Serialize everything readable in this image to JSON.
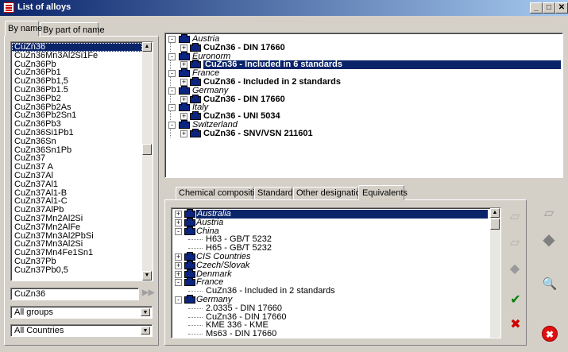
{
  "window": {
    "title": "List of alloys",
    "minimize": "_",
    "maximize": "□",
    "close": "✕"
  },
  "left_tabs": {
    "by_name": "By name",
    "by_part": "By part of name"
  },
  "alloys": [
    "CuZn36",
    "CuZn36Mn3Al2Si1Fe",
    "CuZn36Pb",
    "CuZn36Pb1",
    "CuZn36Pb1,5",
    "CuZn36Pb1.5",
    "CuZn36Pb2",
    "CuZn36Pb2As",
    "CuZn36Pb2Sn1",
    "CuZn36Pb3",
    "CuZn36Si1Pb1",
    "CuZn36Sn",
    "CuZn36Sn1Pb",
    "CuZn37",
    "CuZn37 A",
    "CuZn37Al",
    "CuZn37Al1",
    "CuZn37Al1-B",
    "CuZn37Al1-C",
    "CuZn37AlPb",
    "CuZn37Mn2Al2Si",
    "CuZn37Mn2AlFe",
    "CuZn37Mn3Al2PbSi",
    "CuZn37Mn3Al2Si",
    "CuZn37Mn4Fe1Sn1",
    "CuZn37Pb",
    "CuZn37Pb0,5"
  ],
  "search": {
    "value": "CuZn36",
    "go": "▶▶"
  },
  "groups": {
    "value": "All groups"
  },
  "countries": {
    "value": "All Countries"
  },
  "standards_tree": [
    {
      "country": "Austria",
      "entry": "CuZn36  -  DIN 17660",
      "selected": false
    },
    {
      "country": "Euronorm",
      "entry": "CuZn36  -  Included in 6 standards",
      "selected": true
    },
    {
      "country": "France",
      "entry": "CuZn36  -  Included in 2 standards",
      "selected": false
    },
    {
      "country": "Germany",
      "entry": "CuZn36  -  DIN 17660",
      "selected": false
    },
    {
      "country": "Italy",
      "entry": "CuZn36  -  UNI 5034",
      "selected": false
    },
    {
      "country": "Switzerland",
      "entry": "CuZn36  -  SNV/VSN 211601",
      "selected": false
    }
  ],
  "detail_tabs": [
    "Chemical composition",
    "Standards",
    "Other designations",
    "Equivalents"
  ],
  "equivalents": [
    {
      "label": "Australia",
      "type": "country",
      "expander": "+",
      "selected": true
    },
    {
      "label": "Austria",
      "type": "country",
      "expander": "+"
    },
    {
      "label": "China",
      "type": "country",
      "expander": "-"
    },
    {
      "label": "H63  -  GB/T 5232",
      "type": "leaf"
    },
    {
      "label": "H65  -  GB/T 5232",
      "type": "leaf"
    },
    {
      "label": "CIS Countries",
      "type": "country",
      "expander": "+"
    },
    {
      "label": "Czech/Slovak",
      "type": "country",
      "expander": "+"
    },
    {
      "label": "Denmark",
      "type": "country",
      "expander": "+"
    },
    {
      "label": "France",
      "type": "country",
      "expander": "-"
    },
    {
      "label": "CuZn36  -  Included in 2 standards",
      "type": "leaf"
    },
    {
      "label": "Germany",
      "type": "country",
      "expander": "-"
    },
    {
      "label": "2.0335  -  DIN 17660",
      "type": "leaf"
    },
    {
      "label": "CuZn36  -  DIN 17660",
      "type": "leaf"
    },
    {
      "label": "KME 336  -  KME",
      "type": "leaf"
    },
    {
      "label": "Ms63  -  DIN 17660",
      "type": "leaf"
    }
  ],
  "icons": {
    "check": "✔",
    "cross": "✖",
    "magnifier": "🔍",
    "close_circle": "✖"
  },
  "colors": {
    "selection": "#0a246a",
    "check": "#008000",
    "cross": "#d00000",
    "close_circle": "#e01010"
  }
}
